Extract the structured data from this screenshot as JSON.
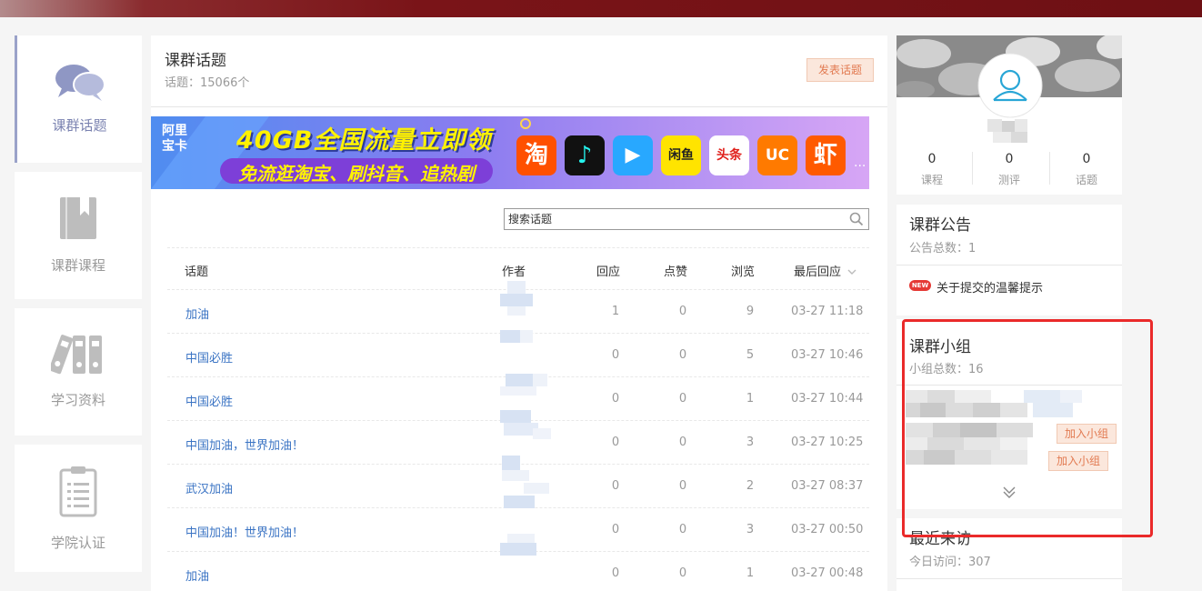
{
  "nav": {
    "items": [
      {
        "label": "课群话题",
        "icon": "chat-bubbles-icon",
        "active": true
      },
      {
        "label": "课群课程",
        "icon": "book-icon",
        "active": false
      },
      {
        "label": "学习资料",
        "icon": "binders-icon",
        "active": false
      },
      {
        "label": "学院认证",
        "icon": "clipboard-icon",
        "active": false
      }
    ]
  },
  "main": {
    "title": "课群话题",
    "count": "话题：15066个",
    "post_button": "发表话题",
    "banner": {
      "brand_line1": "阿里",
      "brand_line2": "宝卡",
      "headline": "40GB全国流量立即领",
      "subline": "免流逛淘宝、刷抖音、追热剧",
      "app_icons": [
        "淘",
        "♪",
        "▶",
        "闲鱼",
        "头条",
        "UC",
        "虾"
      ],
      "more": "..."
    },
    "search": {
      "placeholder": "搜索话题"
    },
    "table": {
      "headers": {
        "topic": "话题",
        "author": "作者",
        "replies": "回应",
        "likes": "点赞",
        "views": "浏览",
        "last_reply": "最后回应"
      },
      "rows": [
        {
          "title": "加油",
          "replies": "1",
          "likes": "0",
          "views": "9",
          "last": "03-27 11:18"
        },
        {
          "title": "中国必胜",
          "replies": "0",
          "likes": "0",
          "views": "5",
          "last": "03-27 10:46"
        },
        {
          "title": "中国必胜",
          "replies": "0",
          "likes": "0",
          "views": "1",
          "last": "03-27 10:44"
        },
        {
          "title": "中国加油，世界加油！",
          "replies": "0",
          "likes": "0",
          "views": "3",
          "last": "03-27 10:25"
        },
        {
          "title": "武汉加油",
          "replies": "0",
          "likes": "0",
          "views": "2",
          "last": "03-27 08:37"
        },
        {
          "title": "中国加油！世界加油！",
          "replies": "0",
          "likes": "0",
          "views": "3",
          "last": "03-27 00:50"
        },
        {
          "title": "加油",
          "replies": "0",
          "likes": "0",
          "views": "1",
          "last": "03-27 00:48"
        }
      ]
    }
  },
  "profile": {
    "stats": [
      {
        "value": "0",
        "label": "课程"
      },
      {
        "value": "0",
        "label": "测评"
      },
      {
        "value": "0",
        "label": "话题"
      }
    ]
  },
  "notice": {
    "title": "课群公告",
    "count": "公告总数：1",
    "badge": "NEW",
    "item": "关于提交的温馨提示"
  },
  "groups": {
    "title": "课群小组",
    "count": "小组总数：16",
    "join_label": "加入小组"
  },
  "visitors": {
    "title": "最近来访",
    "count": "今日访问：307"
  },
  "colors": {
    "accent": "#3b74c4",
    "button_bg": "#fbe7dc",
    "button_text": "#e27a51",
    "highlight": "#ea2a2a"
  }
}
